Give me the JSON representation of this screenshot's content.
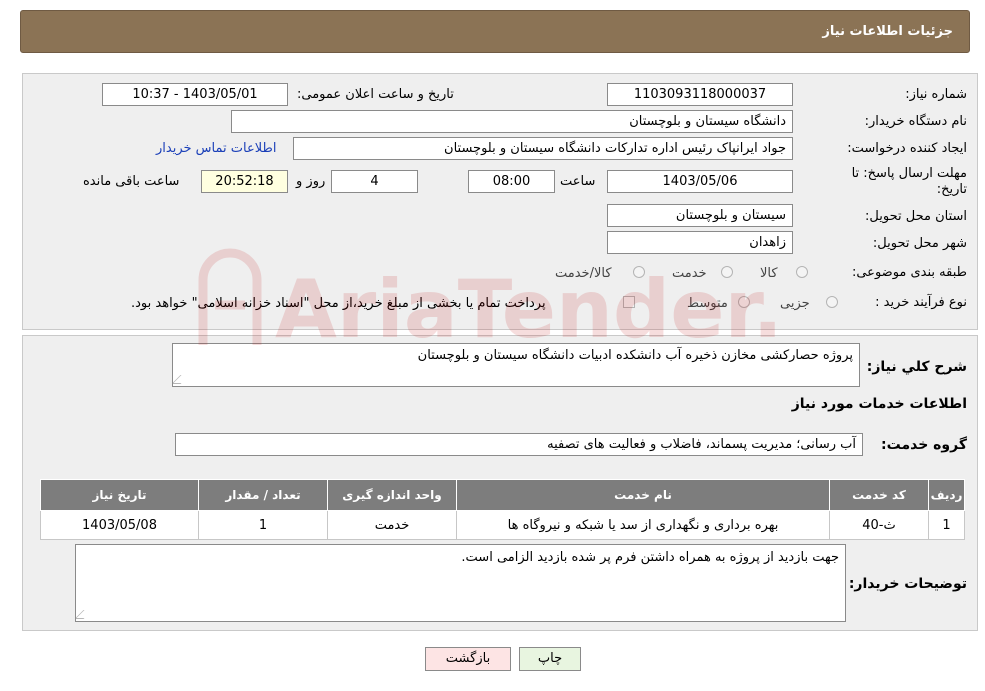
{
  "header": {
    "title": "جزئیات اطلاعات نیاز"
  },
  "form": {
    "need_number_label": "شماره نیاز:",
    "need_number": "1103093118000037",
    "announce_label": "تاریخ و ساعت اعلان عمومی:",
    "announce_value": "1403/05/01 - 10:37",
    "buyer_org_label": "نام دستگاه خریدار:",
    "buyer_org": "دانشگاه سیستان و بلوچستان",
    "creator_label": "ایجاد کننده درخواست:",
    "creator": "جواد ایرانپاک رئیس اداره تدارکات دانشگاه سیستان و بلوچستان",
    "contact_link": "اطلاعات تماس خریدار",
    "deadline_label": "مهلت ارسال پاسخ: تا تاریخ:",
    "deadline_date": "1403/05/06",
    "time_label": "ساعت",
    "deadline_time": "08:00",
    "days": "4",
    "days_label": "روز و",
    "remaining_time": "20:52:18",
    "remaining_label": "ساعت باقی مانده",
    "province_label": "استان محل تحویل:",
    "province": "سیستان و بلوچستان",
    "city_label": "شهر محل تحویل:",
    "city": "زاهدان",
    "category_label": "طبقه بندی موضوعی:",
    "category_options": [
      "کالا",
      "خدمت",
      "کالا/خدمت"
    ],
    "purchase_type_label": "نوع فرآیند خرید :",
    "purchase_options": [
      "جزیی",
      "متوسط"
    ],
    "payment_note": "پرداخت تمام یا بخشی از مبلغ خرید،از محل \"اسناد خزانه اسلامی\" خواهد بود."
  },
  "details": {
    "summary_label": "شرح کلي نياز:",
    "summary": "پروژه حصارکشی مخازن ذخیره آب دانشکده ادبیات دانشگاه سیستان و بلوچستان",
    "services_title": "اطلاعات خدمات مورد نیاز",
    "service_group_label": "گروه خدمت:",
    "service_group": "آب رسانی؛ مدیریت پسماند، فاضلاب و فعالیت های تصفیه",
    "table": {
      "headers": [
        "ردیف",
        "کد خدمت",
        "نام خدمت",
        "واحد اندازه گیری",
        "تعداد / مقدار",
        "تاریخ نیاز"
      ],
      "rows": [
        [
          "1",
          "ث-40",
          "بهره برداری و نگهداری از سد یا شبکه و نیروگاه ها",
          "خدمت",
          "1",
          "1403/05/08"
        ]
      ]
    },
    "buyer_notes_label": "توضیحات خریدار:",
    "buyer_notes": "جهت بازدید از پروژه به همراه داشتن فرم پر شده بازدید الزامی است."
  },
  "buttons": {
    "print": "چاپ",
    "back": "بازگشت"
  },
  "watermark": {
    "text": "AriaTender.neT"
  },
  "colors": {
    "header_bg": "#8b7355",
    "table_header_bg": "#7d7d7d",
    "link": "#1a3fb8",
    "back_button_bg": "#fde4e4",
    "print_button_bg": "#e8f5e0"
  }
}
